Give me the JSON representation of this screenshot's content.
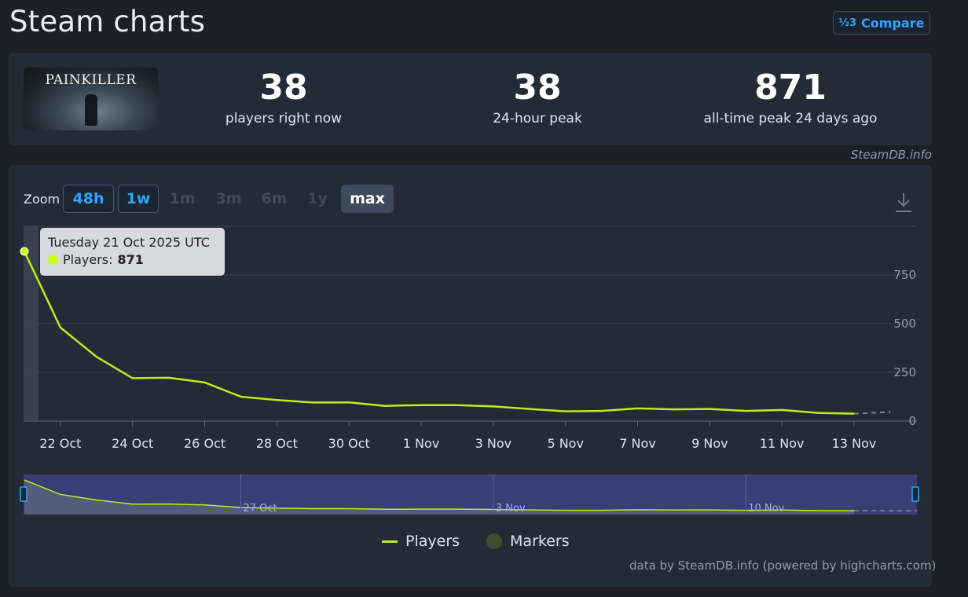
{
  "page": {
    "title": "Steam charts",
    "compare_label": "Compare",
    "compare_icon": "fraction-icon"
  },
  "stats": {
    "game_name": "PAINKILLER",
    "players_now": "38",
    "players_now_label": "players right now",
    "peak_24h": "38",
    "peak_24h_label": "24-hour peak",
    "all_time_peak": "871",
    "all_time_peak_label": "all-time peak 24 days ago"
  },
  "credit_top": "SteamDB.info",
  "zoom": {
    "label": "Zoom",
    "options": [
      {
        "label": "48h",
        "state": "enabled"
      },
      {
        "label": "1w",
        "state": "enabled"
      },
      {
        "label": "1m",
        "state": "disabled"
      },
      {
        "label": "3m",
        "state": "disabled"
      },
      {
        "label": "6m",
        "state": "disabled"
      },
      {
        "label": "1y",
        "state": "disabled"
      },
      {
        "label": "max",
        "state": "selected"
      }
    ]
  },
  "tooltip": {
    "date": "Tuesday 21 Oct 2025 UTC",
    "series_label": "Players:",
    "value": "871"
  },
  "legend": {
    "players": "Players",
    "markers": "Markers"
  },
  "credit_bottom": "data by SteamDB.info (powered by highcharts.com)",
  "colors": {
    "line": "#b9f01b",
    "background": "#1b2028",
    "panel": "#232b36",
    "accent": "#2fa4ff",
    "navigator_fill": "#373f75"
  },
  "chart_data": {
    "type": "line",
    "ylim": [
      0,
      1000
    ],
    "y_ticks": [
      0,
      250,
      500,
      750
    ],
    "x_tick_labels": [
      "22 Oct",
      "24 Oct",
      "26 Oct",
      "28 Oct",
      "30 Oct",
      "1 Nov",
      "3 Nov",
      "5 Nov",
      "7 Nov",
      "9 Nov",
      "11 Nov",
      "13 Nov"
    ],
    "x_tick_day_index": [
      1,
      3,
      5,
      7,
      9,
      11,
      13,
      15,
      17,
      19,
      21,
      23
    ],
    "series": [
      {
        "name": "Players",
        "x": [
          "21 Oct",
          "22 Oct",
          "23 Oct",
          "24 Oct",
          "25 Oct",
          "26 Oct",
          "27 Oct",
          "28 Oct",
          "29 Oct",
          "30 Oct",
          "31 Oct",
          "1 Nov",
          "2 Nov",
          "3 Nov",
          "4 Nov",
          "5 Nov",
          "6 Nov",
          "7 Nov",
          "8 Nov",
          "9 Nov",
          "10 Nov",
          "11 Nov",
          "12 Nov",
          "13 Nov"
        ],
        "values": [
          871,
          480,
          330,
          220,
          222,
          198,
          125,
          108,
          95,
          96,
          78,
          82,
          82,
          75,
          62,
          50,
          52,
          65,
          60,
          62,
          52,
          57,
          42,
          38
        ]
      }
    ],
    "navigator_labels": [
      "27 Oct",
      "3 Nov",
      "10 Nov"
    ],
    "navigator_label_day_index": [
      6,
      13,
      20
    ]
  }
}
